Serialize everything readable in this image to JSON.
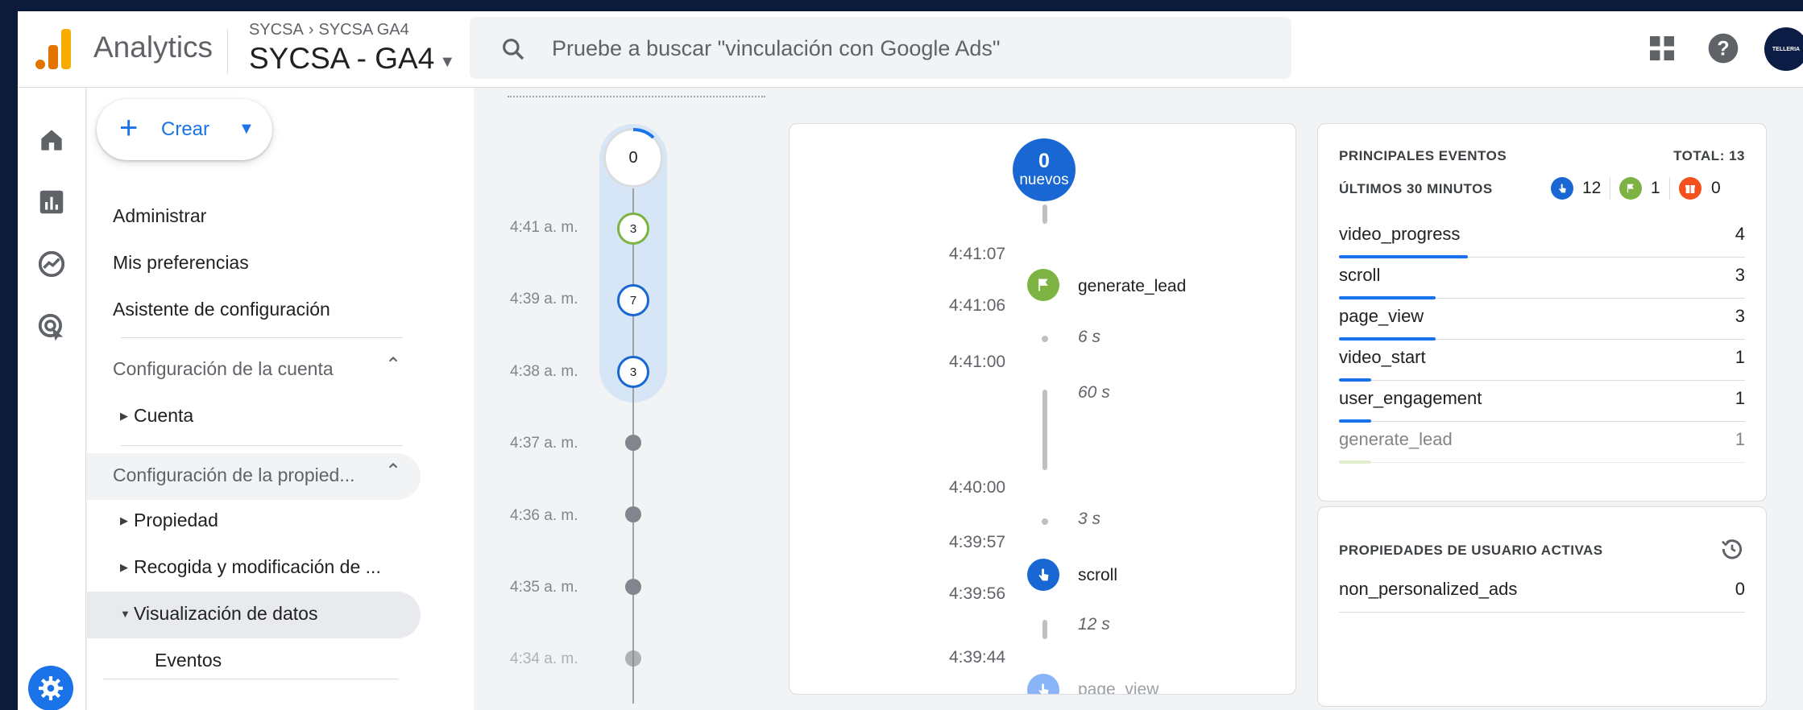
{
  "header": {
    "product": "Analytics",
    "breadcrumb": [
      "SYCSA",
      "SYCSA GA4"
    ],
    "property": "SYCSA - GA4",
    "search_placeholder": "Pruebe a buscar \"vinculación con Google Ads\"",
    "avatar_text": "TELLERIA"
  },
  "nav": {
    "create_label": "Crear",
    "items": {
      "admin": "Administrar",
      "prefs": "Mis preferencias",
      "wizard": "Asistente de configuración",
      "account_section": "Configuración de la cuenta",
      "account": "Cuenta",
      "property_section": "Configuración de la propied...",
      "property": "Propiedad",
      "collection": "Recogida y modificación de ...",
      "display": "Visualización de datos",
      "events": "Eventos"
    }
  },
  "timeline": {
    "top_count": "0",
    "rows": [
      {
        "time": "4:41 a. m.",
        "count": "3"
      },
      {
        "time": "4:39 a. m.",
        "count": "7"
      },
      {
        "time": "4:38 a. m.",
        "count": "3"
      },
      {
        "time": "4:37 a. m.",
        "count": ""
      },
      {
        "time": "4:36 a. m.",
        "count": ""
      },
      {
        "time": "4:35 a. m.",
        "count": ""
      },
      {
        "time": "4:34 a. m.",
        "count": ""
      }
    ]
  },
  "stream": {
    "new_count": "0",
    "new_label": "nuevos",
    "times": [
      "4:41:07",
      "4:41:06",
      "4:41:00",
      "4:40:00",
      "4:39:57",
      "4:39:56",
      "4:39:44"
    ],
    "events": [
      "generate_lead",
      "scroll",
      "page_view"
    ],
    "durations": [
      "6 s",
      "60 s",
      "3 s",
      "12 s"
    ]
  },
  "top_events": {
    "title": "PRINCIPALES EVENTOS",
    "total": "TOTAL: 13",
    "subtitle": "ÚLTIMOS 30 MINUTOS",
    "badges": [
      {
        "icon": "touch-icon",
        "value": "12",
        "color": "#1967d2"
      },
      {
        "icon": "flag-icon",
        "value": "1",
        "color": "#7cb342"
      },
      {
        "icon": "gift-icon",
        "value": "0",
        "color": "#f4511e"
      }
    ],
    "rows": [
      {
        "name": "video_progress",
        "value": "4",
        "fraction": 1.0
      },
      {
        "name": "scroll",
        "value": "3",
        "fraction": 0.75
      },
      {
        "name": "page_view",
        "value": "3",
        "fraction": 0.75
      },
      {
        "name": "video_start",
        "value": "1",
        "fraction": 0.25
      },
      {
        "name": "user_engagement",
        "value": "1",
        "fraction": 0.25
      },
      {
        "name": "generate_lead",
        "value": "1",
        "fraction": 0.25
      }
    ]
  },
  "user_props": {
    "title": "PROPIEDADES DE USUARIO ACTIVAS",
    "rows": [
      {
        "name": "non_personalized_ads",
        "value": "0"
      }
    ]
  },
  "colors": {
    "accent": "#1a73e8",
    "green": "#7cb342",
    "orange": "#f4511e"
  }
}
